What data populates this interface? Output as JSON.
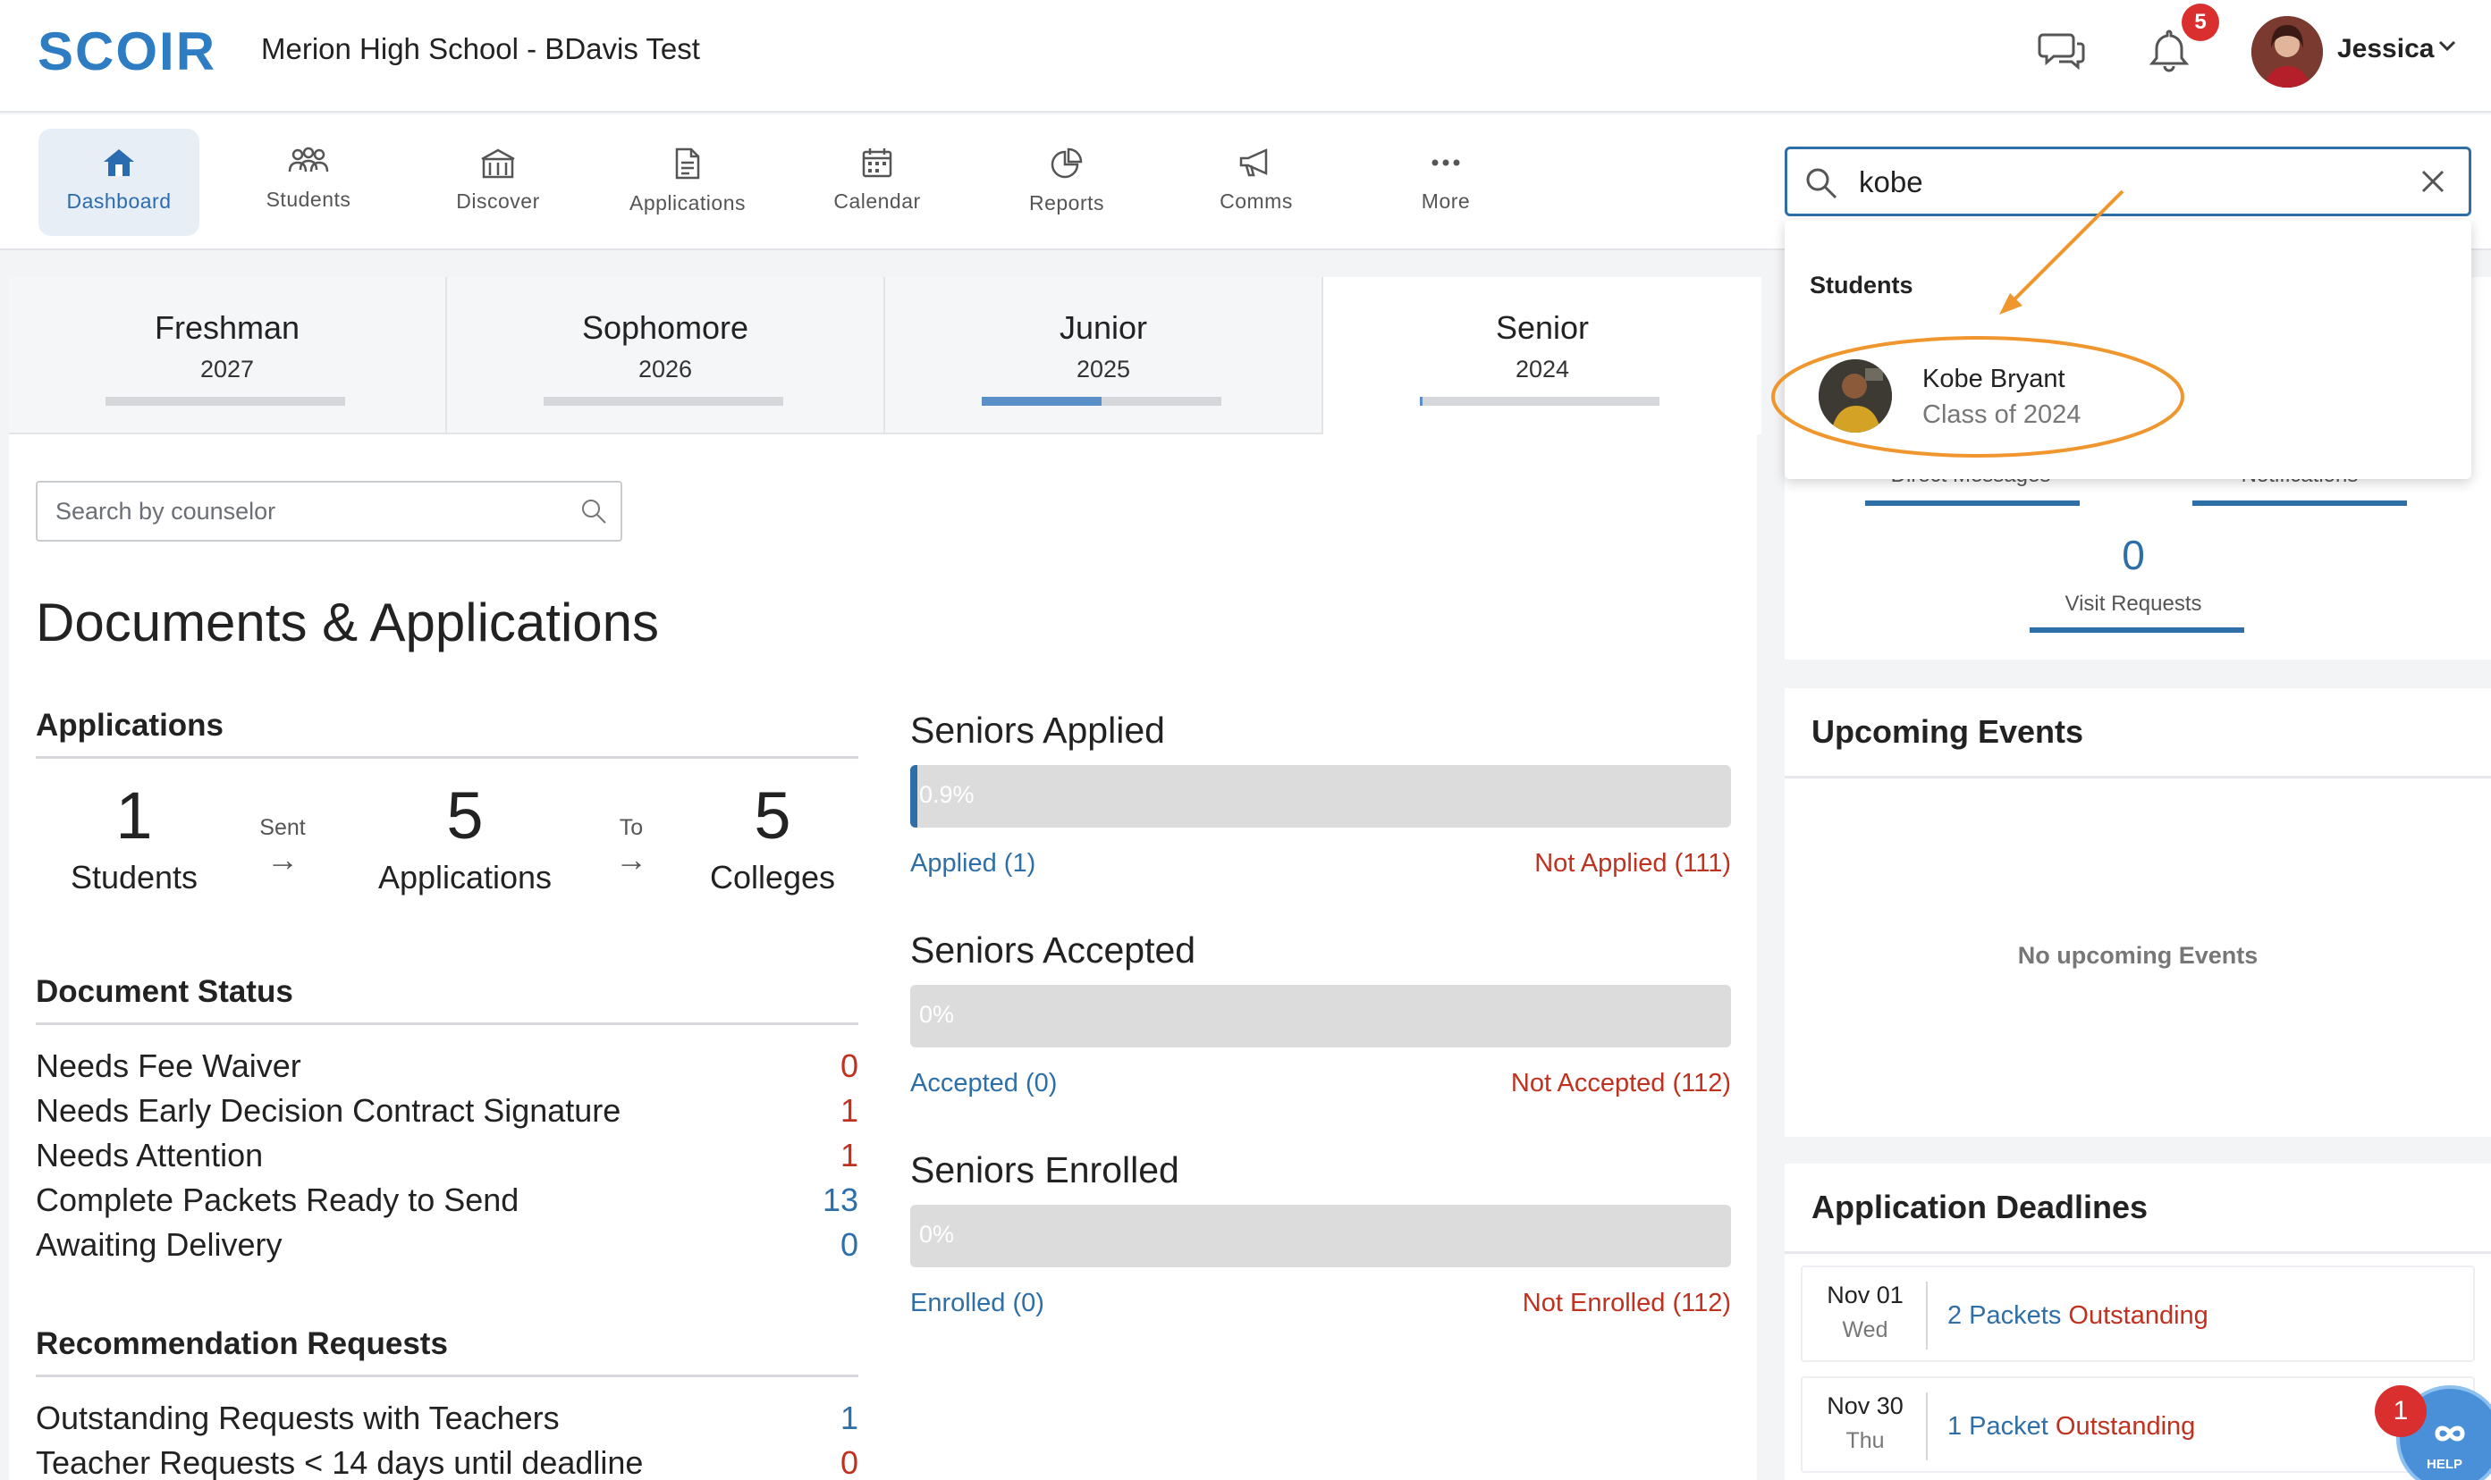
{
  "header": {
    "logo_text": "SCOIR",
    "school": "Merion High School - BDavis Test",
    "notification_count": "5",
    "user_name": "Jessica"
  },
  "nav": {
    "items": [
      {
        "label": "Dashboard",
        "icon": "home-icon"
      },
      {
        "label": "Students",
        "icon": "people-icon"
      },
      {
        "label": "Discover",
        "icon": "college-icon"
      },
      {
        "label": "Applications",
        "icon": "document-icon"
      },
      {
        "label": "Calendar",
        "icon": "calendar-icon"
      },
      {
        "label": "Reports",
        "icon": "pie-chart-icon"
      },
      {
        "label": "Comms",
        "icon": "megaphone-icon"
      },
      {
        "label": "More",
        "icon": "more-dots-icon"
      }
    ],
    "active": "Dashboard"
  },
  "search": {
    "value": "kobe",
    "results_heading": "Students",
    "results": [
      {
        "name": "Kobe Bryant",
        "subtitle": "Class of 2024"
      }
    ]
  },
  "class_tabs": [
    {
      "name": "Freshman",
      "year": "2027",
      "progress": 0
    },
    {
      "name": "Sophomore",
      "year": "2026",
      "progress": 0
    },
    {
      "name": "Junior",
      "year": "2025",
      "progress": 0.5
    },
    {
      "name": "Senior",
      "year": "2024",
      "progress": 0.01
    }
  ],
  "counselor_search": {
    "placeholder": "Search by counselor"
  },
  "documents": {
    "title": "Documents & Applications",
    "applications": {
      "heading": "Applications",
      "students_num": "1",
      "students_label": "Students",
      "sent_label": "Sent",
      "applications_num": "5",
      "applications_label": "Applications",
      "to_label": "To",
      "colleges_num": "5",
      "colleges_label": "Colleges"
    },
    "document_status": {
      "heading": "Document Status",
      "rows": [
        {
          "label": "Needs Fee Waiver",
          "value": "0"
        },
        {
          "label": "Needs Early Decision Contract Signature",
          "value": "1"
        },
        {
          "label": "Needs Attention",
          "value": "1"
        },
        {
          "label": "Complete Packets Ready to Send",
          "value": "13"
        },
        {
          "label": "Awaiting Delivery",
          "value": "0"
        }
      ]
    },
    "recommendations": {
      "heading": "Recommendation Requests",
      "rows": [
        {
          "label": "Outstanding Requests with Teachers",
          "value": "1"
        },
        {
          "label": "Teacher Requests < 14 days until deadline",
          "value": "0"
        }
      ]
    }
  },
  "seniors": [
    {
      "title": "Seniors Applied",
      "percent_text": "0.9%",
      "fraction": 0.009,
      "left": "Applied (1)",
      "right": "Not Applied (111)"
    },
    {
      "title": "Seniors Accepted",
      "percent_text": "0%",
      "fraction": 0,
      "left": "Accepted (0)",
      "right": "Not Accepted (112)"
    },
    {
      "title": "Seniors Enrolled",
      "percent_text": "0%",
      "fraction": 0,
      "left": "Enrolled (0)",
      "right": "Not Enrolled (112)"
    }
  ],
  "counts": {
    "direct_messages_label": "Direct Messages",
    "notifications_label": "Notifications",
    "visit_requests_num": "0",
    "visit_requests_label": "Visit Requests"
  },
  "events": {
    "heading": "Upcoming Events",
    "empty": "No upcoming Events"
  },
  "deadlines": {
    "heading": "Application Deadlines",
    "rows": [
      {
        "date": "Nov 01",
        "day": "Wed",
        "count": "2 Packets",
        "status": "Outstanding"
      },
      {
        "date": "Nov 30",
        "day": "Thu",
        "count": "1 Packet",
        "status": "Outstanding"
      }
    ]
  },
  "help": {
    "label": "HELP",
    "badge": "1"
  },
  "colors": {
    "accent": "#2e6fa8",
    "alert": "#c0311f",
    "annotation": "#f0962e"
  }
}
